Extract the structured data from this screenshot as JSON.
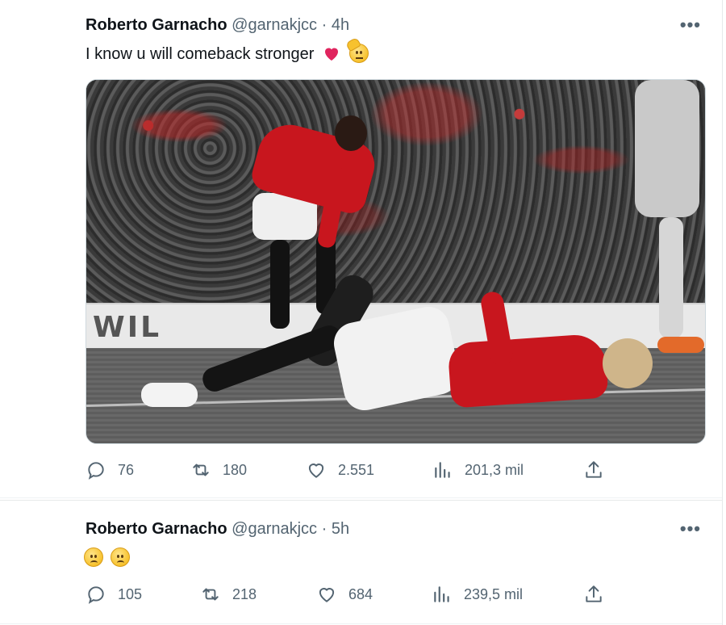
{
  "tweets": [
    {
      "author_name": "Roberto Garnacho",
      "handle": "@garnakjcc",
      "separator": "·",
      "time": "4h",
      "more": "•••",
      "text": "I know u will comeback stronger",
      "emojis": [
        "red-heart",
        "saluting-face"
      ],
      "has_media": true,
      "media_board_text": "WIL",
      "replies": "76",
      "retweets": "180",
      "likes": "2.551",
      "views": "201,3 mil"
    },
    {
      "author_name": "Roberto Garnacho",
      "handle": "@garnakjcc",
      "separator": "·",
      "time": "5h",
      "more": "•••",
      "text": "",
      "emojis": [
        "slightly-frowning-face",
        "slightly-frowning-face"
      ],
      "has_media": false,
      "replies": "105",
      "retweets": "218",
      "likes": "684",
      "views": "239,5 mil"
    }
  ],
  "icons": {
    "reply": "reply-icon",
    "retweet": "retweet-icon",
    "like": "heart-icon",
    "views": "views-icon",
    "share": "share-icon"
  },
  "colors": {
    "text_primary": "#0f1419",
    "text_secondary": "#536471",
    "divider": "#eff3f4",
    "heart": "#e0245e"
  }
}
